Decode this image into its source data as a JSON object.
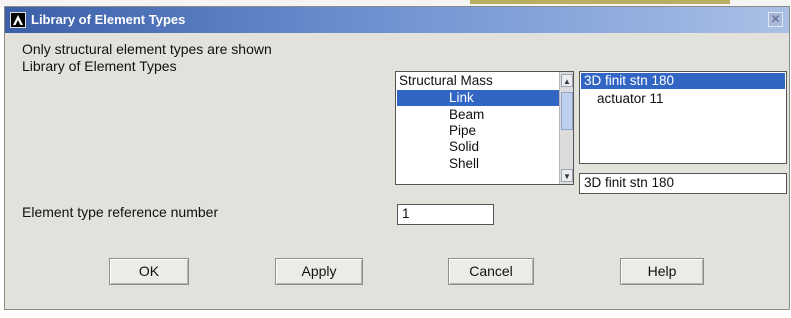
{
  "dialog": {
    "title": "Library of Element Types",
    "note": "Only structural element types are shown",
    "library_label": "Library of Element Types",
    "categories": [
      "Structural Mass",
      "Link",
      "Beam",
      "Pipe",
      "Solid",
      "Shell"
    ],
    "selected_category": "Link",
    "types": [
      "3D finit stn 180",
      "actuator  11"
    ],
    "selected_type": "3D finit stn 180",
    "type_field_value": "3D finit stn 180",
    "ref_label": "Element type reference number",
    "ref_value": "1",
    "buttons": {
      "ok": "OK",
      "apply": "Apply",
      "cancel": "Cancel",
      "help": "Help"
    }
  },
  "icons": {
    "app": "ansys-logo-icon",
    "close": "close-icon",
    "scroll_up": "chevron-up-icon",
    "scroll_down": "chevron-down-icon"
  },
  "colors": {
    "selection": "#3265c4",
    "dialog_bg": "#e2e1dc",
    "title_start": "#3a5fa8",
    "title_end": "#aac0e6"
  }
}
